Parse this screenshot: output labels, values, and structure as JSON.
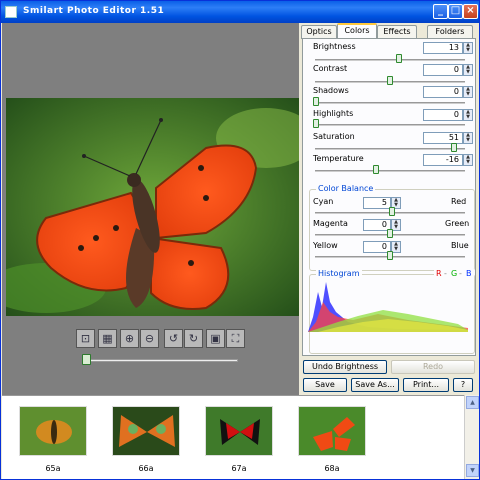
{
  "window": {
    "title": "Smilart  Photo  Editor  1.51"
  },
  "tabs": [
    "Optics",
    "Colors",
    "Effects",
    "Folders"
  ],
  "adjustments": [
    {
      "name": "brightness",
      "label": "Brightness",
      "value": "13"
    },
    {
      "name": "contrast",
      "label": "Contrast",
      "value": "0"
    },
    {
      "name": "shadows",
      "label": "Shadows",
      "value": "0"
    },
    {
      "name": "highlights",
      "label": "Highlights",
      "value": "0"
    },
    {
      "name": "saturation",
      "label": "Saturation",
      "value": "51"
    },
    {
      "name": "temperature",
      "label": "Temperature",
      "value": "-16"
    }
  ],
  "color_balance": {
    "title": "Color Balance",
    "rows": [
      {
        "left": "Cyan",
        "right": "Red",
        "value": "5"
      },
      {
        "left": "Magenta",
        "right": "Green",
        "value": "0"
      },
      {
        "left": "Yellow",
        "right": "Blue",
        "value": "0"
      }
    ]
  },
  "histogram": {
    "title": "Histogram",
    "r": "R",
    "g": "G",
    "b": "B",
    "sep": "-"
  },
  "buttons": {
    "undo": "Undo Brightness",
    "redo": "Redo",
    "save": "Save",
    "save_as": "Save As...",
    "print": "Print...",
    "help": "?"
  },
  "thumbnails": [
    "65a",
    "66a",
    "67a",
    "68a"
  ],
  "colors": {
    "titlebar": "#0054e3",
    "red": "#e00000",
    "green": "#00b000",
    "blue": "#0030ff"
  }
}
